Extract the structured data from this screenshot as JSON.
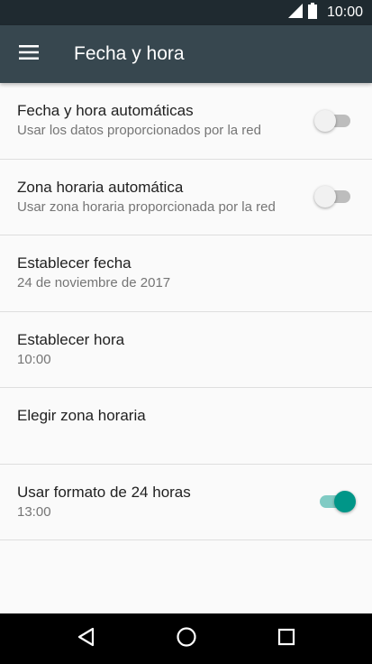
{
  "status_bar": {
    "time": "10:00",
    "icons": [
      "signal-icon",
      "battery-icon"
    ]
  },
  "app_bar": {
    "menu_icon": "menu-icon",
    "title": "Fecha y hora"
  },
  "settings": [
    {
      "title": "Fecha y hora automáticas",
      "summary": "Usar los datos proporcionados por la red",
      "switch": "off"
    },
    {
      "title": "Zona horaria automática",
      "summary": "Usar zona horaria proporcionada por la red",
      "switch": "off"
    },
    {
      "title": "Establecer fecha",
      "summary": "24 de noviembre de 2017"
    },
    {
      "title": "Establecer hora",
      "summary": "10:00"
    },
    {
      "title": "Elegir zona horaria",
      "summary": ""
    },
    {
      "title": "Usar formato de 24 horas",
      "summary": "13:00",
      "switch": "on"
    }
  ],
  "nav_bar": {
    "icons": [
      "back-icon",
      "home-icon",
      "recents-icon"
    ]
  },
  "colors": {
    "status_bar": "#1f2a30",
    "app_bar": "#37474f",
    "accent": "#009688",
    "accent_track": "#80cbc4",
    "background": "#fafafa"
  }
}
